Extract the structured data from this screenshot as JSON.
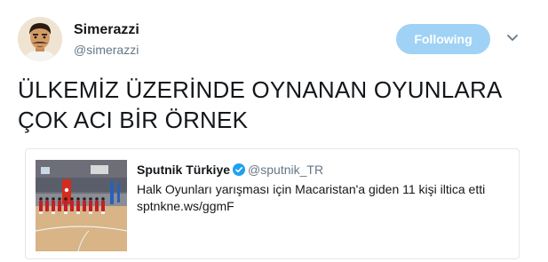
{
  "author": {
    "display_name": "Simerazzi",
    "screen_name": "@simerazzi",
    "avatar_icon": "cartoon-man-avatar"
  },
  "actions": {
    "follow_label": "Following",
    "follow_color": "#9fd2f5",
    "menu_icon": "chevron-down-icon"
  },
  "tweet": {
    "text_lines": [
      "ÜLKEMİZ ÜZERİNDE OYNANAN OYUNLARA",
      "ÇOK ACI BİR ÖRNEK"
    ]
  },
  "quoted_tweet": {
    "display_name": "Sputnik Türkiye",
    "verified": true,
    "verified_icon": "verified-badge-icon",
    "verified_color": "#1da1f2",
    "screen_name": "@sputnik_TR",
    "text_lines": [
      "Halk Oyunları yarışması için Macaristan'a giden 11 kişi iltica etti",
      "sptnkne.ws/ggmF"
    ],
    "media_icon": "folk-dance-stage-photo"
  }
}
